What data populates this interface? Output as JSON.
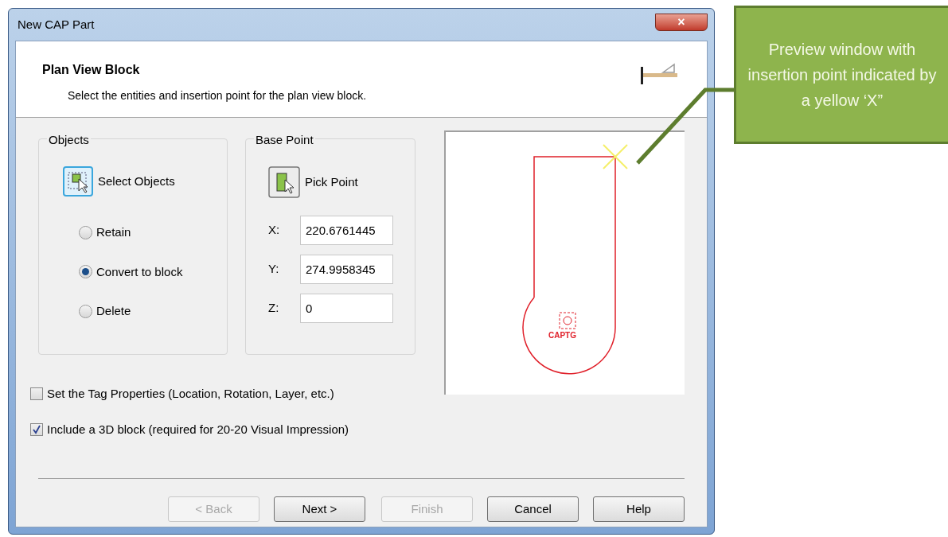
{
  "window": {
    "title": "New CAP Part",
    "close": "×"
  },
  "header": {
    "title": "Plan View Block",
    "subtitle": "Select the entities and insertion point for the plan view block."
  },
  "objects": {
    "title": "Objects",
    "button": "Select Objects",
    "options": [
      {
        "label": "Retain",
        "selected": false
      },
      {
        "label": "Convert to block",
        "selected": true
      },
      {
        "label": "Delete",
        "selected": false
      }
    ]
  },
  "base_point": {
    "title": "Base Point",
    "button": "Pick Point",
    "fields": [
      {
        "label": "X:",
        "value": "220.6761445"
      },
      {
        "label": "Y:",
        "value": "274.9958345"
      },
      {
        "label": "Z:",
        "value": "0"
      }
    ]
  },
  "preview": {
    "tag": "CAPTG"
  },
  "checkboxes": [
    {
      "label": "Set the Tag Properties (Location, Rotation, Layer, etc.)",
      "checked": false
    },
    {
      "label": "Include a 3D block (required for 20-20 Visual Impression)",
      "checked": true
    }
  ],
  "buttons": [
    {
      "label": "< Back",
      "disabled": true
    },
    {
      "label": "Next >",
      "disabled": false
    },
    {
      "label": "Finish",
      "disabled": true
    },
    {
      "label": "Cancel",
      "disabled": false
    },
    {
      "label": "Help",
      "disabled": false
    }
  ],
  "callout": {
    "text": "Preview window with insertion point indicated by a yellow ‘X”"
  }
}
